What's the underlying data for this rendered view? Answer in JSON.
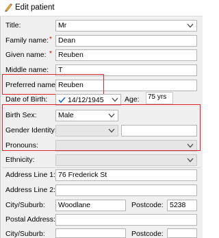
{
  "window": {
    "title": "Edit patient",
    "icon": "pencil-icon"
  },
  "form": {
    "title": {
      "label": "Title:",
      "value": "Mr"
    },
    "family_name": {
      "label": "Family name:",
      "required": "*",
      "value": "Dean"
    },
    "given_name": {
      "label": "Given name:",
      "required": "*",
      "value": "Reuben"
    },
    "middle_name": {
      "label": "Middle name:",
      "value": "T"
    },
    "preferred_name": {
      "label": "Preferred name:",
      "value": "Reuben"
    },
    "dob": {
      "label": "Date of Birth:",
      "value": "14/12/1945",
      "checked": true
    },
    "age": {
      "label": "Age:",
      "value": "75 yrs"
    },
    "birth_sex": {
      "label": "Birth Sex:",
      "value": "Male"
    },
    "gender_identity": {
      "label": "Gender Identity:",
      "value": "",
      "other": ""
    },
    "pronouns": {
      "label": "Pronouns:",
      "value": ""
    },
    "ethnicity": {
      "label": "Ethnicity:",
      "value": ""
    },
    "address1": {
      "label": "Address Line 1:",
      "value": "76 Frederick St"
    },
    "address2": {
      "label": "Address Line 2:",
      "value": ""
    },
    "city": {
      "label": "City/Suburb:",
      "value": "Woodlane"
    },
    "postcode": {
      "label": "Postcode:",
      "value": "5238"
    },
    "postal_address": {
      "label": "Postal Address:",
      "value": ""
    },
    "city2": {
      "label": "City/Suburb:",
      "value": ""
    },
    "postcode2": {
      "label": "Postcode:",
      "value": ""
    }
  },
  "colors": {
    "highlight_box": "#e0242c",
    "required": "#e00000",
    "check": "#1e64c8"
  }
}
